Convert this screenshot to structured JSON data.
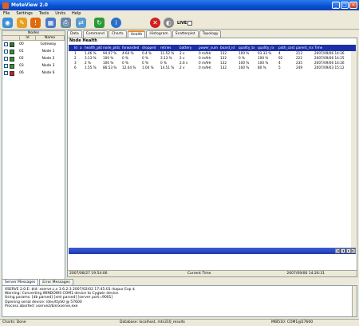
{
  "window": {
    "title": "MoteView 2.0"
  },
  "menu": [
    "File",
    "Settings",
    "Tools",
    "Units",
    "Help"
  ],
  "toolbar": {
    "live_label": "LIVE"
  },
  "nodes": {
    "header": "Nodes",
    "col_id": "Id",
    "col_name": "Name",
    "items": [
      {
        "id": "00",
        "name": "Gateway"
      },
      {
        "id": "01",
        "name": "Node 1"
      },
      {
        "id": "02",
        "name": "Node 2"
      },
      {
        "id": "03",
        "name": "Node 3"
      },
      {
        "id": "06",
        "name": "Node 6"
      }
    ]
  },
  "tabs": [
    "Data",
    "Command",
    "Charts",
    "Health",
    "Histogram",
    "Scatterplot",
    "Topology"
  ],
  "health": {
    "section_title": "Node Health",
    "columns": [
      "",
      "Id",
      "a",
      "health_pkts",
      "node_pkts",
      "forwarded",
      "dropped",
      "retries",
      "battery",
      "power_sum",
      "board_id",
      "quality_tx",
      "quality_rx",
      "path_cost",
      "parent_rssi",
      "Time"
    ],
    "rows": [
      [
        "",
        "1",
        "",
        "1.46 %",
        "94.07 %",
        "4.64 %",
        "0.4 %",
        "11.52 %",
        "2 v",
        "0 mAHr",
        "132",
        "100 %",
        "93.33 %",
        "4",
        "213",
        "2007/09/06 14:26"
      ],
      [
        "",
        "2",
        "",
        "3.13 %",
        "100 %",
        "0 %",
        "0 %",
        "3.13 %",
        "2 v",
        "0 mAHr",
        "132",
        "0 %",
        "100 %",
        "92",
        "222",
        "2007/09/06 14:25"
      ],
      [
        "",
        "3",
        "",
        "2 %",
        "100 %",
        "0 %",
        "0 %",
        "0 %",
        "2.6 v",
        "0 mAHr",
        "132",
        "100 %",
        "100 %",
        "4",
        "235",
        "2007/09/06 14:26"
      ],
      [
        "",
        "6",
        "",
        "1.55 %",
        "86.53 %",
        "12.44 %",
        "1.04 %",
        "14.51 %",
        "2 v",
        "0 mAHr",
        "132",
        "100 %",
        "80 %",
        "5",
        "249",
        "2007/09/03 15:12"
      ]
    ]
  },
  "timeline": {
    "start": "2007/08/27 19:54:06",
    "label": "Current Time",
    "end": "2007/09/06 14:26:31"
  },
  "console_tabs": [
    "Server Messages",
    "Error Messages"
  ],
  "console_lines": [
    "XSERVE 2.0.E: $Id: xserve.c,v 1.6.2.3 2007/02/02 17:45:01 rkapur Exp $",
    "Warning: Converting WINDOWS COM1 device to Cygwin device.",
    "Using params: [db parsed] [xml parsed] [server port=9001]",
    "Opening serial device: /dev/ttyS0 @ 57600",
    "Process aborted: xserve2/bin/xserve.exe"
  ],
  "status": {
    "left": "Charts: Done",
    "db": "Database: localhost, mts310_results",
    "port": "MIB510: COM1@57600"
  }
}
